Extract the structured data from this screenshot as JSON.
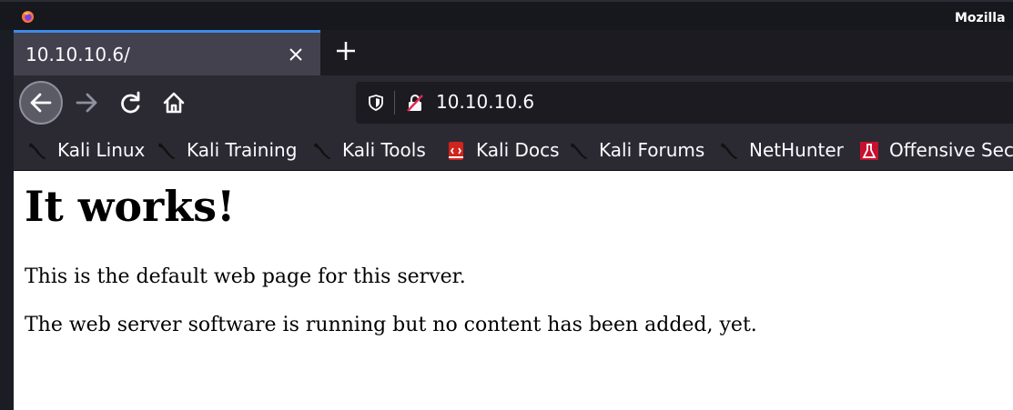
{
  "window": {
    "title": "Mozilla",
    "app_icon": "firefox-icon"
  },
  "tabs": [
    {
      "label": "10.10.10.6/",
      "active": true
    }
  ],
  "toolbar": {
    "url": "10.10.10.6",
    "icons": [
      "back-icon",
      "forward-icon",
      "reload-icon",
      "home-icon",
      "tracking-protection-shield-icon",
      "insecure-lock-icon"
    ]
  },
  "bookmarks": [
    {
      "label": "Kali Linux",
      "icon": "kali-dragon-icon"
    },
    {
      "label": "Kali Training",
      "icon": "kali-dragon-icon"
    },
    {
      "label": "Kali Tools",
      "icon": "kali-dragon-icon"
    },
    {
      "label": "Kali Docs",
      "icon": "kali-docs-icon"
    },
    {
      "label": "Kali Forums",
      "icon": "kali-dragon-icon"
    },
    {
      "label": "NetHunter",
      "icon": "kali-dragon-icon"
    },
    {
      "label": "Offensive Secu",
      "icon": "offensive-security-icon"
    }
  ],
  "page": {
    "heading": "It works!",
    "paragraphs": [
      "This is the default web page for this server.",
      "The web server software is running but no content has been added, yet."
    ]
  },
  "colors": {
    "tab_accent": "#3d8be8",
    "toolbar_bg": "#2b2a33",
    "urlbar_bg": "#1c1b22",
    "page_bg": "#ffffff"
  }
}
